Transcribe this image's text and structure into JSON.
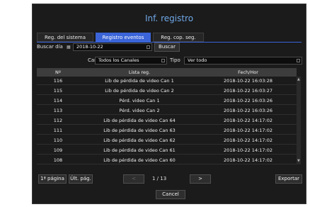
{
  "title": "Inf. registro",
  "tabs": [
    "Reg. del sistema",
    "Registro eventos",
    "Reg. cop. seg."
  ],
  "search": {
    "label": "Buscar día",
    "date": "2018-10-22",
    "button": "Buscar"
  },
  "filters": {
    "channel_label": "Can",
    "channel_value": "Todos los Canales",
    "type_label": "Tipo",
    "type_value": "Ver todo"
  },
  "table": {
    "headers": [
      "Nº",
      "Lista reg.",
      "Fech/Hor"
    ],
    "rows": [
      [
        "116",
        "Lib de pérdida de video Can 1",
        "2018-10-22 16:03:28"
      ],
      [
        "115",
        "Lib de pérdida de video Can 2",
        "2018-10-22 16:03:27"
      ],
      [
        "114",
        "Pérd. video Can 1",
        "2018-10-22 16:03:26"
      ],
      [
        "113",
        "Pérd. video Can 2",
        "2018-10-22 16:03:26"
      ],
      [
        "112",
        "Lib de pérdida de video Can 64",
        "2018-10-22 14:17:02"
      ],
      [
        "111",
        "Lib de pérdida de video Can 63",
        "2018-10-22 14:17:02"
      ],
      [
        "110",
        "Lib de pérdida de video Can 62",
        "2018-10-22 14:17:02"
      ],
      [
        "109",
        "Lib de pérdida de video Can 61",
        "2018-10-22 14:17:02"
      ],
      [
        "108",
        "Lib de pérdida de video Can 60",
        "2018-10-22 14:17:02"
      ]
    ]
  },
  "pagination": {
    "first": "1ª página",
    "last": "Últ. pág.",
    "prev": "<",
    "next": ">",
    "page": "1 / 13"
  },
  "export_label": "Exportar",
  "cancel_label": "Cancel"
}
